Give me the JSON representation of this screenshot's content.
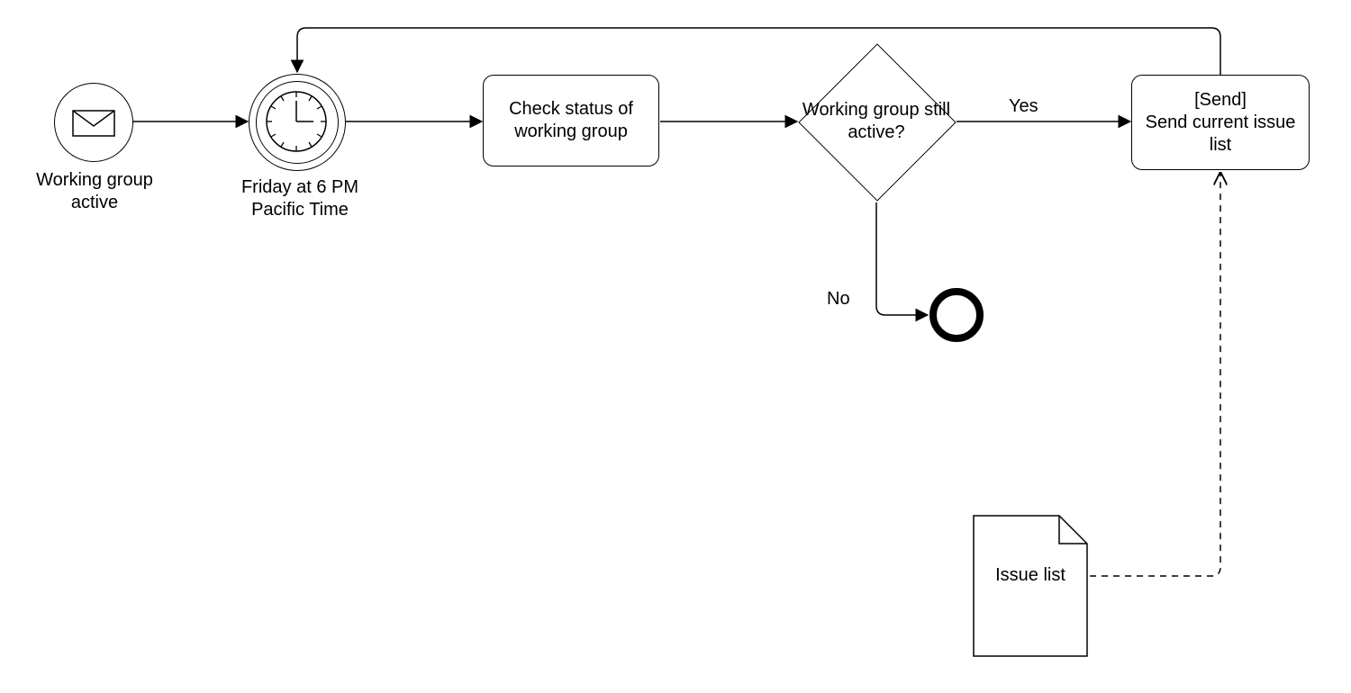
{
  "diagram": {
    "startEvent": {
      "label": "Working group active",
      "icon": "envelope-icon"
    },
    "timerEvent": {
      "label": "Friday at 6 PM Pacific Time",
      "icon": "clock-icon"
    },
    "task1": {
      "label": "Check status of working group"
    },
    "gateway": {
      "label": "Working group still active?"
    },
    "edgeYes": {
      "label": "Yes"
    },
    "edgeNo": {
      "label": "No"
    },
    "task2": {
      "label": "[Send]\nSend current issue list"
    },
    "endEvent": {
      "label": ""
    },
    "dataObject": {
      "label": "Issue list",
      "icon": "document-icon"
    }
  },
  "chart_data": {
    "type": "bpmn-diagram",
    "nodes": [
      {
        "id": "start",
        "kind": "message-start-event",
        "label": "Working group active"
      },
      {
        "id": "timer",
        "kind": "timer-intermediate-event",
        "label": "Friday at 6 PM Pacific Time"
      },
      {
        "id": "checkStatus",
        "kind": "task",
        "label": "Check status of working group"
      },
      {
        "id": "gateway",
        "kind": "exclusive-gateway",
        "label": "Working group still active?"
      },
      {
        "id": "send",
        "kind": "task",
        "label": "[Send] Send current issue list"
      },
      {
        "id": "end",
        "kind": "end-event",
        "label": ""
      },
      {
        "id": "issueList",
        "kind": "data-object",
        "label": "Issue list"
      }
    ],
    "edges": [
      {
        "from": "start",
        "to": "timer",
        "kind": "sequence"
      },
      {
        "from": "timer",
        "to": "checkStatus",
        "kind": "sequence"
      },
      {
        "from": "checkStatus",
        "to": "gateway",
        "kind": "sequence"
      },
      {
        "from": "gateway",
        "to": "send",
        "kind": "sequence",
        "label": "Yes"
      },
      {
        "from": "gateway",
        "to": "end",
        "kind": "sequence",
        "label": "No"
      },
      {
        "from": "send",
        "to": "timer",
        "kind": "sequence-loop"
      },
      {
        "from": "issueList",
        "to": "send",
        "kind": "data-association"
      }
    ]
  }
}
